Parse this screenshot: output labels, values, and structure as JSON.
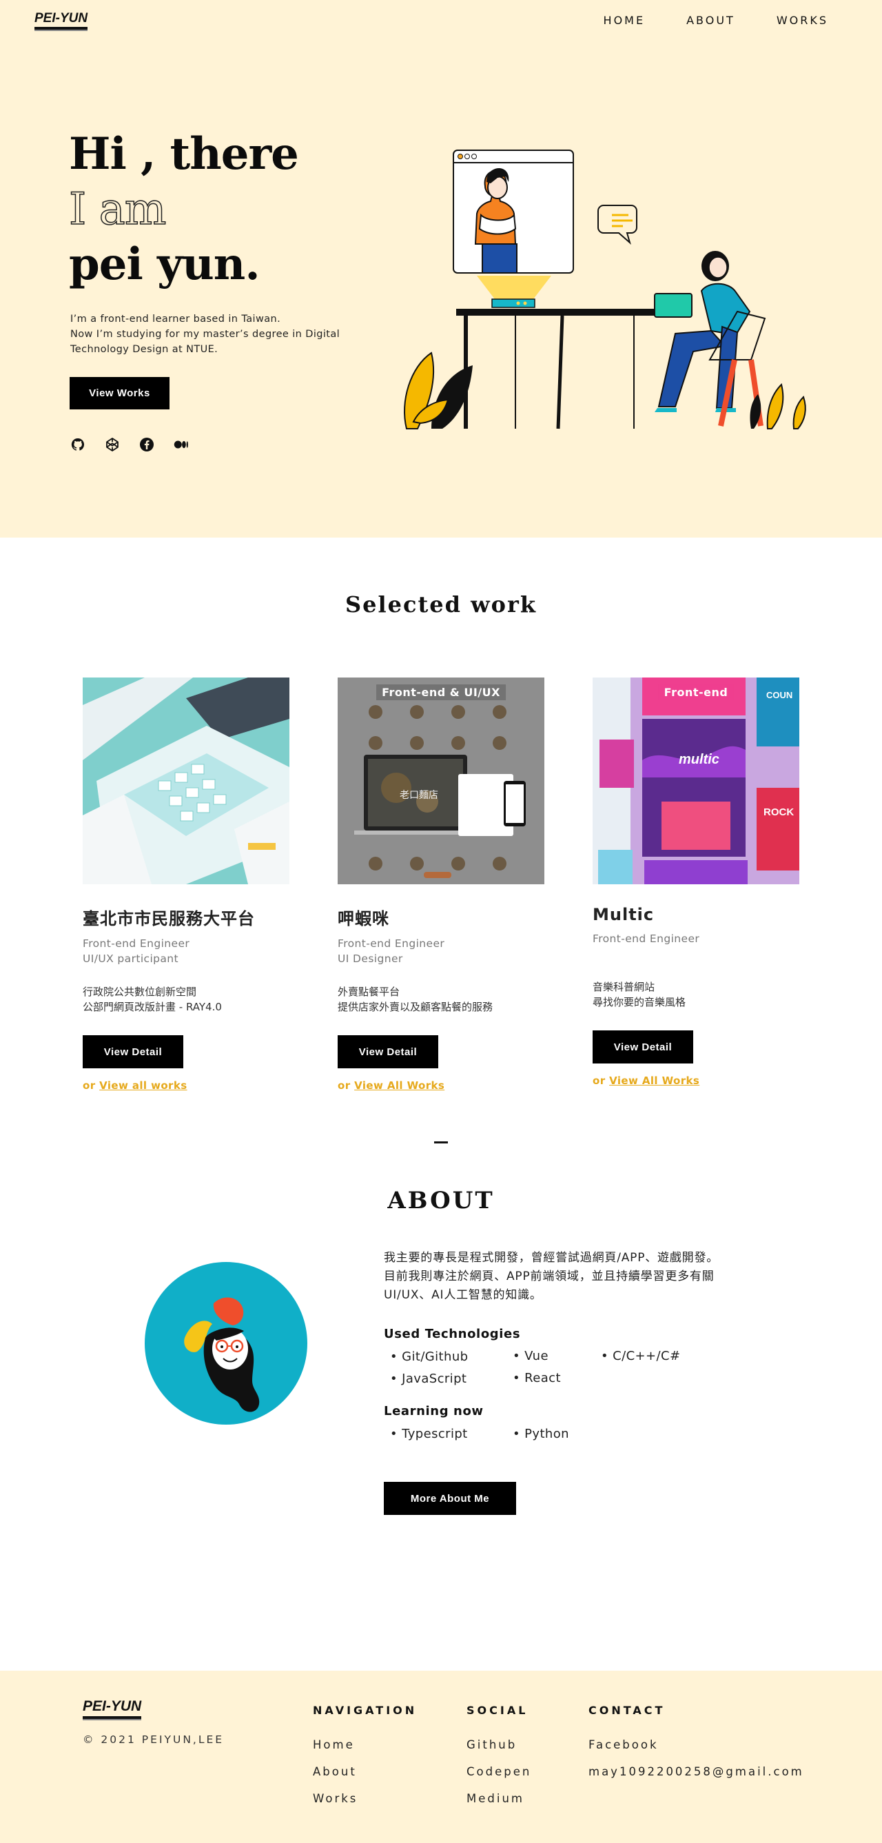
{
  "header": {
    "logo": "PEI-YUN",
    "nav": [
      "HOME",
      "ABOUT",
      "WORKS"
    ]
  },
  "hero": {
    "line1": "Hi , there",
    "line2": "I am",
    "line3": "pei yun.",
    "desc1": "I’m a front-end learner based in Taiwan.",
    "desc2": "Now I’m studying for my master’s degree in Digital Technology Design at NTUE.",
    "button": "View Works",
    "socials": [
      "github-icon",
      "codepen-icon",
      "facebook-icon",
      "medium-icon"
    ]
  },
  "works": {
    "title": "Selected work",
    "cards": [
      {
        "tag": "",
        "name": "臺北市市民服務大平台",
        "role1": "Front-end Engineer",
        "role2": "UI/UX participant",
        "desc1": "行政院公共數位創新空間",
        "desc2": "公部門網頁改版計畫 - RAY4.0",
        "button": "View Detail",
        "more_prefix": "or ",
        "more_link": "View all works"
      },
      {
        "tag": "Front-end & UI/UX",
        "name": "呷蝦咪",
        "role1": "Front-end Engineer",
        "role2": "UI Designer",
        "desc1": "外賣點餐平台",
        "desc2": "提供店家外賣以及顧客點餐的服務",
        "button": "View Detail",
        "more_prefix": "or ",
        "more_link": "View All Works"
      },
      {
        "tag": "Front-end",
        "name": "Multic",
        "role1": "Front-end Engineer",
        "role2": "",
        "desc1": "音樂科普網站",
        "desc2": "尋找你要的音樂風格",
        "button": "View Detail",
        "more_prefix": "or ",
        "more_link": "View All Works"
      }
    ]
  },
  "about": {
    "title": "ABOUT",
    "text1": "我主要的專長是程式開發，曾經嘗試過網頁/APP、遊戲開發。",
    "text2": "目前我則專注於網頁、APP前端領域，並且持續學習更多有關UI/UX、AI人工智慧的知識。",
    "used_title": "Used Technologies",
    "used_col1": [
      "Git/Github",
      "JavaScript"
    ],
    "used_col2": [
      "Vue",
      "React"
    ],
    "used_col3": [
      "C/C++/C#"
    ],
    "learning_title": "Learning now",
    "learning_col1": [
      "Typescript"
    ],
    "learning_col2": [
      "Python"
    ],
    "button": "More About Me"
  },
  "footer": {
    "logo": "PEI-YUN",
    "copyright": "© 2021 PEIYUN,LEE",
    "nav_title": "NAVIGATION",
    "nav_links": [
      "Home",
      "About",
      "Works"
    ],
    "social_title": "SOCIAL",
    "social_links": [
      "Github",
      "Codepen",
      "Medium"
    ],
    "contact_title": "CONTACT",
    "contact_links": [
      "Facebook",
      "may1092200258@gmail.com"
    ]
  },
  "colors": {
    "cream": "#fff3d6",
    "black": "#000000",
    "accent_yellow": "#e6a91c",
    "teal": "#10afc8"
  }
}
